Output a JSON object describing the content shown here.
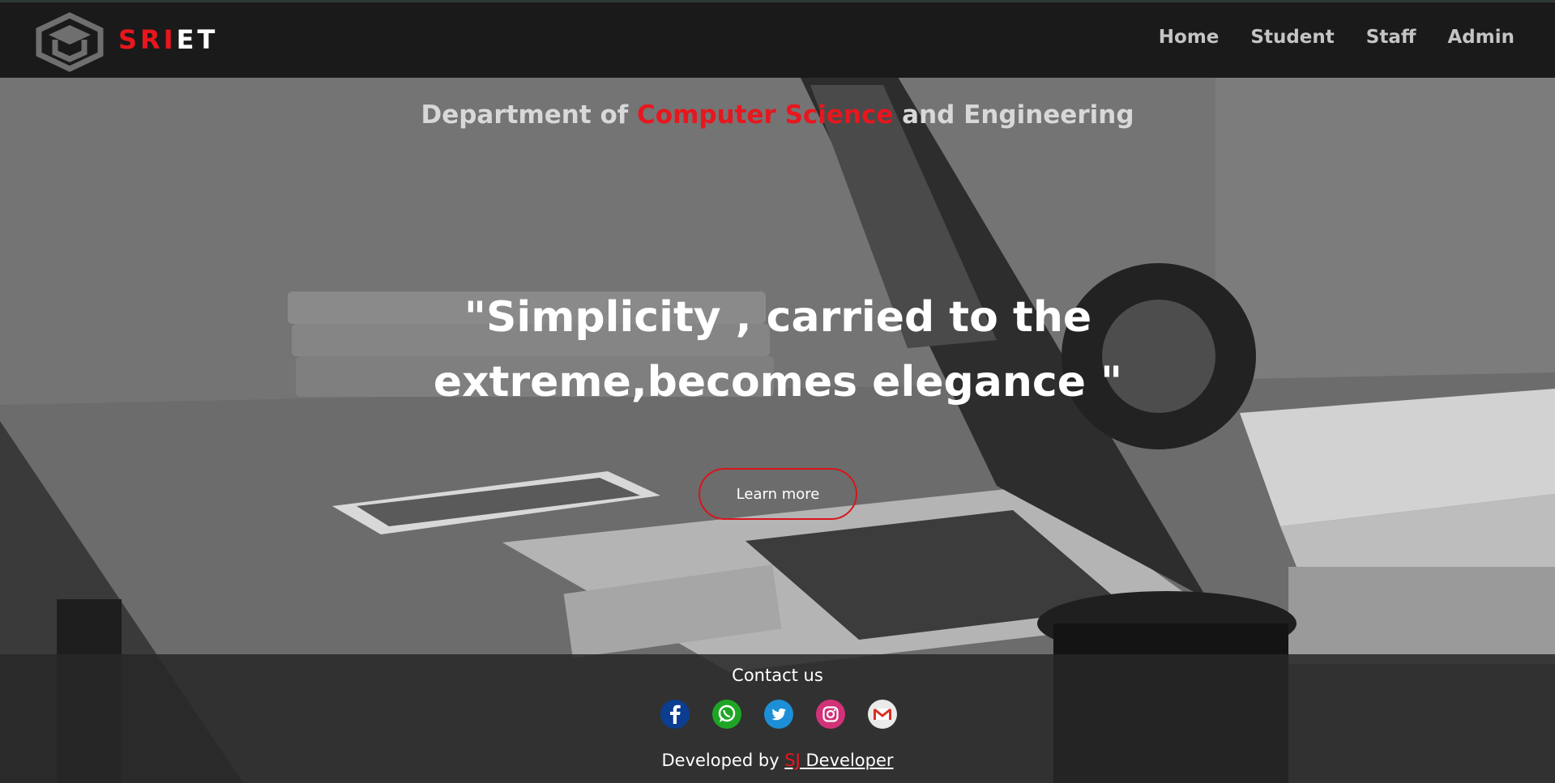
{
  "brand": {
    "part_red": "SRI",
    "part_white": "ET"
  },
  "nav": {
    "items": [
      "Home",
      "Student",
      "Staff",
      "Admin"
    ]
  },
  "hero": {
    "dept_prefix": "Department of ",
    "dept_accent": "Computer Science",
    "dept_suffix": " and Engineering",
    "quote_line1": "\"Simplicity , carried to the",
    "quote_line2": "extreme,becomes elegance \"",
    "button_label": "Learn more"
  },
  "footer": {
    "contact_title": "Contact us",
    "socials": [
      "facebook-icon",
      "whatsapp-icon",
      "twitter-icon",
      "instagram-icon",
      "gmail-icon"
    ],
    "dev_prefix": "Developed by ",
    "dev_link_red": "SJ",
    "dev_link_rest": " Developer"
  },
  "colors": {
    "accent": "#e8161d",
    "nav_bg": "#1a1a1a",
    "nav_text": "#c4c4c4",
    "footer_bg": "#282828"
  }
}
